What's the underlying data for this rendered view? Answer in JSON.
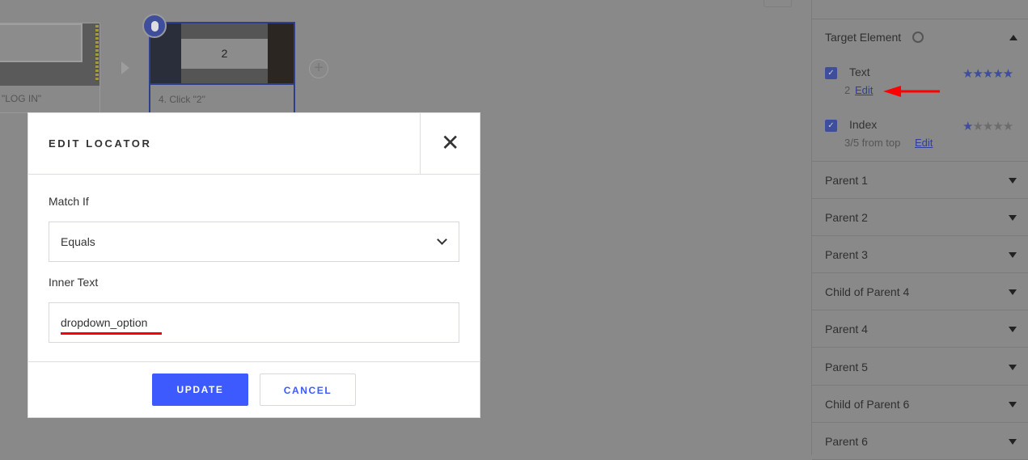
{
  "steps": [
    {
      "caption": "\"LOG IN\""
    },
    {
      "caption": "4. Click \"2\"",
      "thumb_text": "2"
    }
  ],
  "panel": {
    "target_title": "Target Element",
    "locators": [
      {
        "label": "Text",
        "value": "2",
        "edit": "Edit",
        "checked": true,
        "rating": 5,
        "stars": "★★★★★"
      },
      {
        "label": "Index",
        "value": "3/5 from top",
        "edit": "Edit",
        "checked": true,
        "rating": 1,
        "stars_on": "★",
        "stars_off": "★★★★"
      }
    ],
    "sections": [
      "Parent 1",
      "Parent 2",
      "Parent 3",
      "Child of Parent 4",
      "Parent 4",
      "Parent 5",
      "Child of Parent 6",
      "Parent 6"
    ]
  },
  "dialog": {
    "title": "EDIT LOCATOR",
    "match_label": "Match If",
    "match_value": "Equals",
    "inner_label": "Inner Text",
    "inner_value": "dropdown_option",
    "update": "UPDATE",
    "cancel": "CANCEL"
  },
  "colors": {
    "accent": "#3d5afe",
    "annotation": "#ff0000",
    "star": "#3e4d9c"
  }
}
